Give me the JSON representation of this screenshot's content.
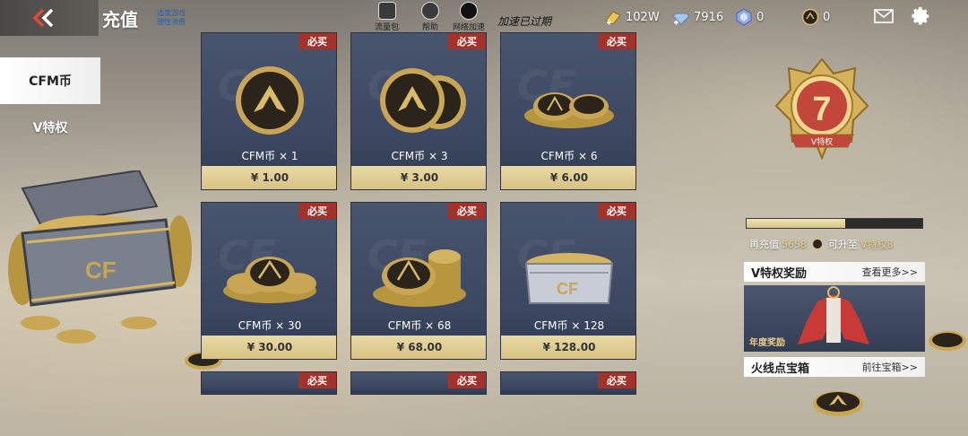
{
  "header": {
    "back_icon": "double-chevron-left-icon",
    "title": "充值",
    "notice_line1": "适度游戏",
    "notice_line2": "理性消费",
    "utilities": [
      {
        "label": "流量包",
        "icon": "data-pack-icon"
      },
      {
        "label": "帮助",
        "icon": "help-icon"
      },
      {
        "label": "网络加速",
        "icon": "network-accel-icon"
      }
    ],
    "accel_status": "加速已过期",
    "currencies": [
      {
        "icon": "gold-coin-plus-icon",
        "value": "102W"
      },
      {
        "icon": "diamond-plus-icon",
        "value": "7916"
      },
      {
        "icon": "blue-gem-icon",
        "value": "0"
      },
      {
        "icon": "cf-coin-plus-icon",
        "value": "0"
      }
    ],
    "mail_icon": "mail-icon",
    "settings_icon": "gear-icon"
  },
  "tabs": [
    {
      "label": "CFM币",
      "active": true
    },
    {
      "label": "V特权",
      "active": false
    }
  ],
  "products": [
    {
      "name": "CFM币 × 1",
      "price": "¥ 1.00",
      "badge": "必买"
    },
    {
      "name": "CFM币 × 3",
      "price": "¥ 3.00",
      "badge": "必买"
    },
    {
      "name": "CFM币 × 6",
      "price": "¥ 6.00",
      "badge": "必买"
    },
    {
      "name": "CFM币 × 30",
      "price": "¥ 30.00",
      "badge": "必买"
    },
    {
      "name": "CFM币 × 68",
      "price": "¥ 68.00",
      "badge": "必买"
    },
    {
      "name": "CFM币 × 128",
      "price": "¥ 128.00",
      "badge": "必买"
    }
  ],
  "more_products_badges": [
    "必买",
    "必买",
    "必买"
  ],
  "vip": {
    "badge_level": "7",
    "badge_label": "V特权",
    "progress": 0.56,
    "recharge_prefix": "再充值",
    "recharge_amount": "5658",
    "recharge_middle": "可升至",
    "target_level": "V特权8",
    "rewards_title": "V特权奖励",
    "rewards_link": "查看更多>>",
    "reward_caption": "年度奖励",
    "chest_title": "火线点宝箱",
    "chest_link": "前往宝箱>>"
  },
  "colors": {
    "badge_red": "#a3322a",
    "price_gold": "#e3d29c",
    "card_navy": "#44506a",
    "accent_gold": "#e6d28e"
  }
}
